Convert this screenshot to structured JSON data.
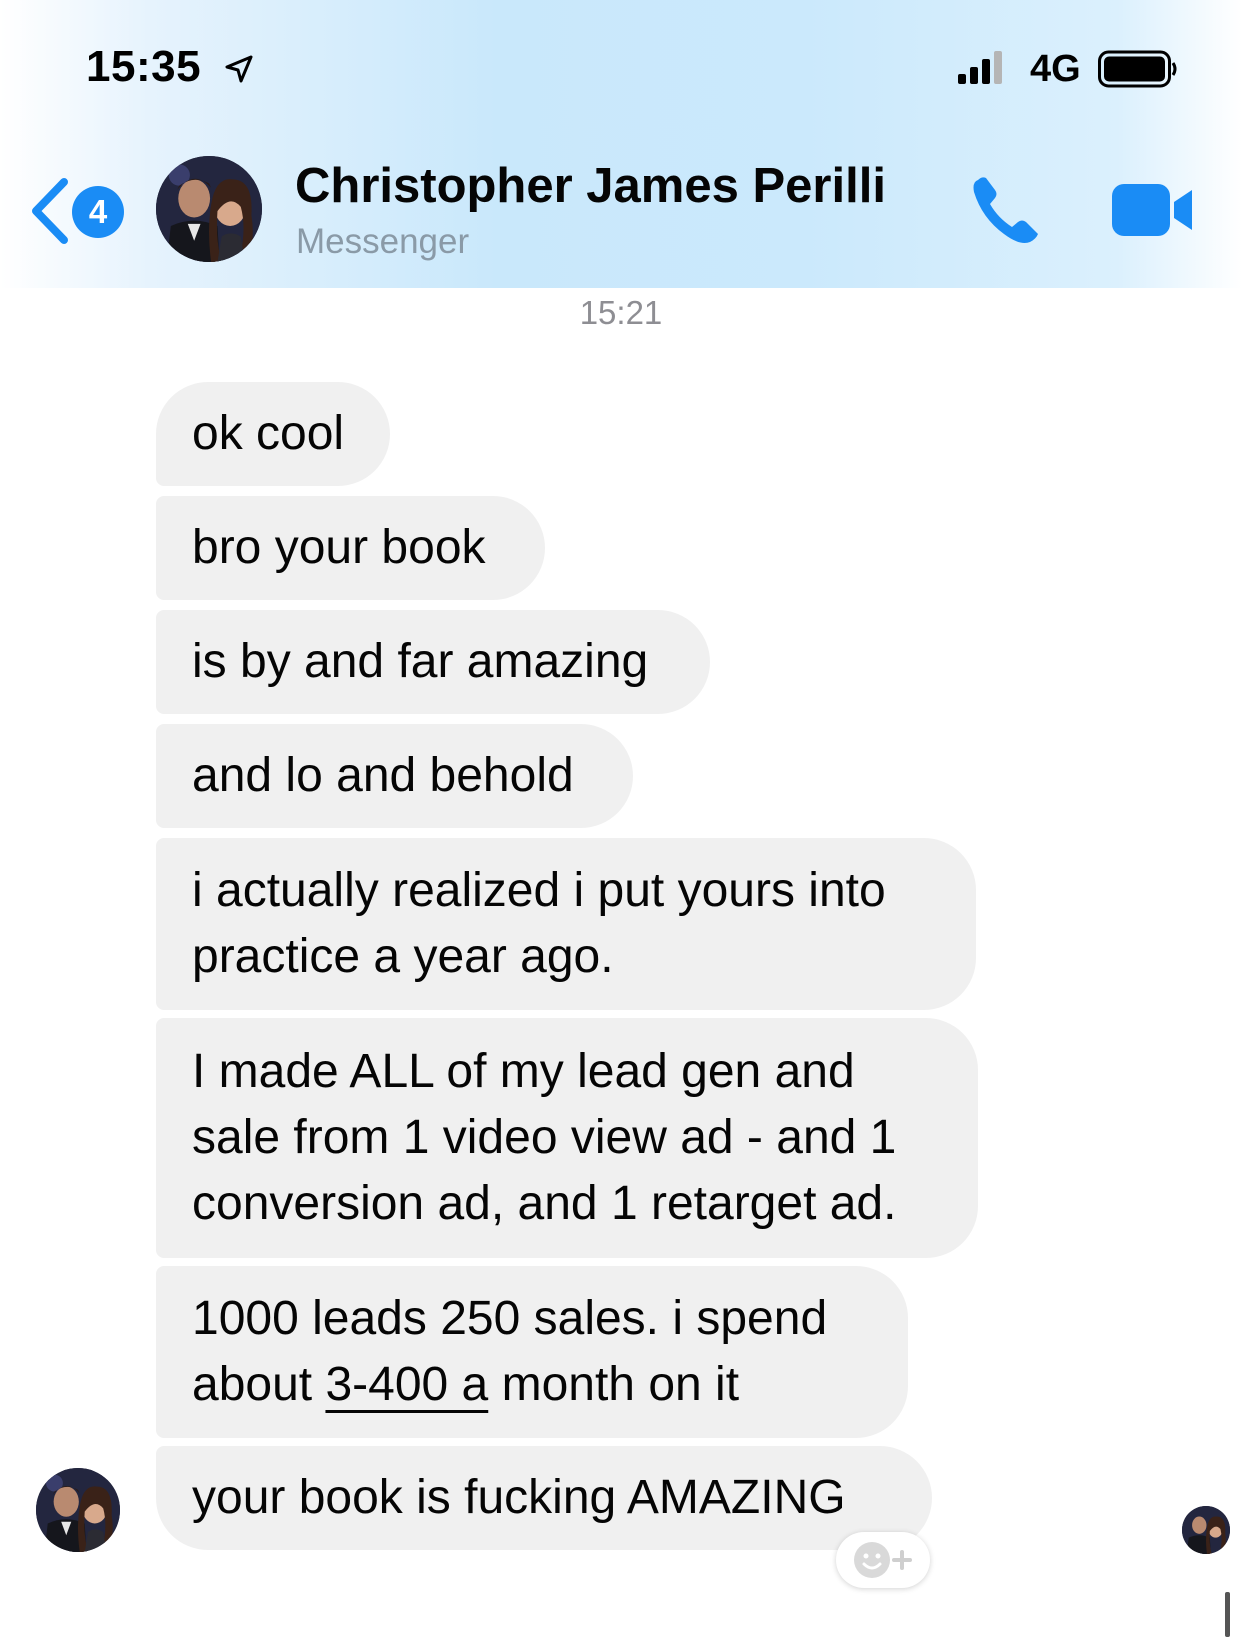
{
  "status_bar": {
    "time": "15:35",
    "network": "4G",
    "icons": [
      "location-arrow-icon",
      "signal-bars-icon",
      "battery-icon"
    ]
  },
  "header": {
    "back_badge_count": "4",
    "contact_name": "Christopher James Perilli",
    "subtitle": "Messenger",
    "icons": [
      "back-chevron-icon",
      "phone-icon",
      "video-camera-icon"
    ],
    "accent_color": "#1a8cf5"
  },
  "conversation": {
    "timestamp": "15:21",
    "messages": [
      {
        "lines": [
          "ok cool"
        ]
      },
      {
        "lines": [
          "bro your book"
        ]
      },
      {
        "lines": [
          "is by and far amazing"
        ]
      },
      {
        "lines": [
          "and lo and behold"
        ]
      },
      {
        "lines": [
          "i actually realized i put yours into",
          "practice a year ago."
        ]
      },
      {
        "lines": [
          "I made ALL of my lead gen and",
          "sale from 1 video view ad - and 1",
          "conversion ad, and 1 retarget ad."
        ]
      },
      {
        "lines": [
          "1000 leads 250 sales. i spend"
        ],
        "line2_before": "about ",
        "line2_underlined": "3-400 a",
        "line2_after": " month on it"
      },
      {
        "lines": [
          "your book is fucking AMAZING"
        ]
      }
    ],
    "bubble_color": "#f0f0f0",
    "reaction_icon": "add-reaction-icon"
  }
}
